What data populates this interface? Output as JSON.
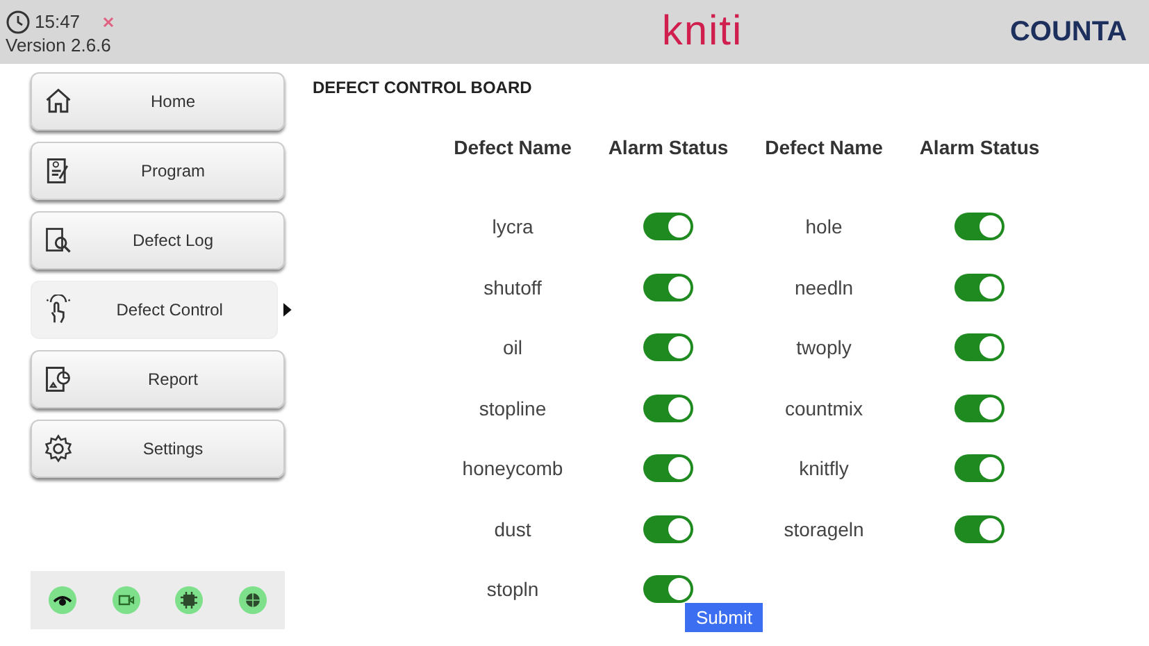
{
  "header": {
    "time": "15:47",
    "version": "Version 2.6.6",
    "logo": "kniti",
    "brand": "COUNTA"
  },
  "sidebar": {
    "items": [
      {
        "label": "Home",
        "selected": false
      },
      {
        "label": "Program",
        "selected": false
      },
      {
        "label": "Defect Log",
        "selected": false
      },
      {
        "label": "Defect Control",
        "selected": true
      },
      {
        "label": "Report",
        "selected": false
      },
      {
        "label": "Settings",
        "selected": false
      }
    ]
  },
  "board": {
    "title": "DEFECT CONTROL BOARD",
    "columns": [
      "Defect Name",
      "Alarm Status",
      "Defect Name",
      "Alarm Status"
    ],
    "rows": [
      [
        {
          "name": "lycra",
          "on": true
        },
        {
          "name": "hole",
          "on": true
        }
      ],
      [
        {
          "name": "shutoff",
          "on": true
        },
        {
          "name": "needln",
          "on": true
        }
      ],
      [
        {
          "name": "oil",
          "on": true
        },
        {
          "name": "twoply",
          "on": true
        }
      ],
      [
        {
          "name": "stopline",
          "on": true
        },
        {
          "name": "countmix",
          "on": true
        }
      ],
      [
        {
          "name": "honeycomb",
          "on": true
        },
        {
          "name": "knitfly",
          "on": true
        }
      ],
      [
        {
          "name": "dust",
          "on": true
        },
        {
          "name": "storageln",
          "on": true
        }
      ],
      [
        {
          "name": "stopln",
          "on": true
        }
      ]
    ],
    "submit": "Submit"
  }
}
